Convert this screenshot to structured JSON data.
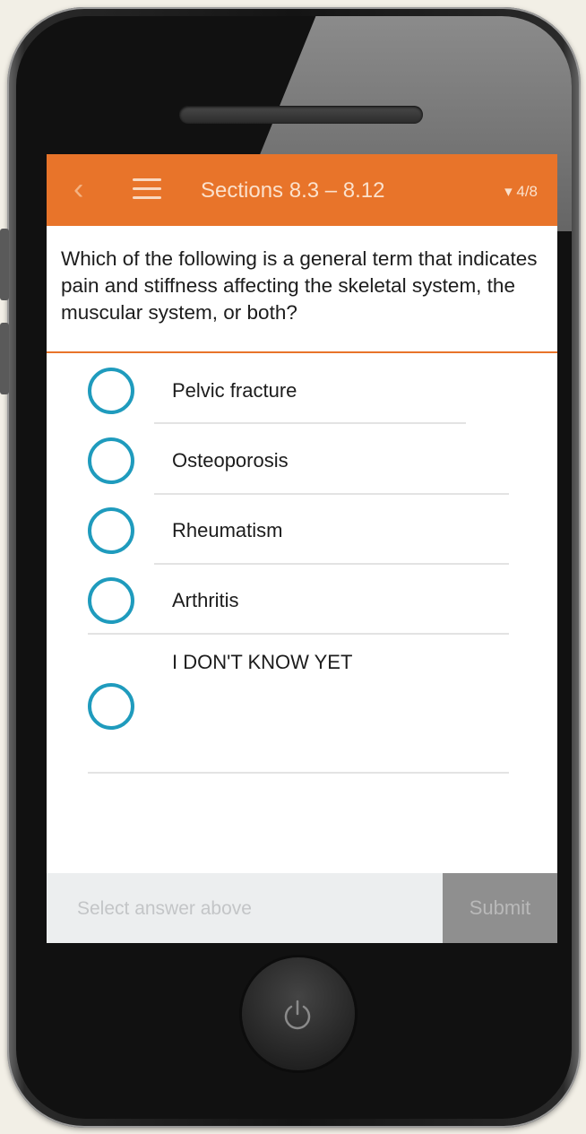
{
  "header": {
    "back_icon": "chevron-left-icon",
    "menu_icon": "hamburger-menu-icon",
    "title": "Sections 8.3 – 8.12",
    "progress": "▾ 4/8"
  },
  "question": {
    "text": "Which of the following is a general term that indicates pain and stiffness affecting the skeletal system, the muscular system, or both?"
  },
  "options": [
    {
      "label": "Pelvic fracture"
    },
    {
      "label": "Osteoporosis"
    },
    {
      "label": "Rheumatism"
    },
    {
      "label": "Arthritis"
    },
    {
      "label": "I DON'T KNOW YET"
    }
  ],
  "footer": {
    "hint": "Select answer above",
    "submit_label": "Submit"
  },
  "device": {
    "home_icon": "power-icon"
  },
  "colors": {
    "accent": "#e8742a",
    "radio": "#1f9bbd"
  }
}
